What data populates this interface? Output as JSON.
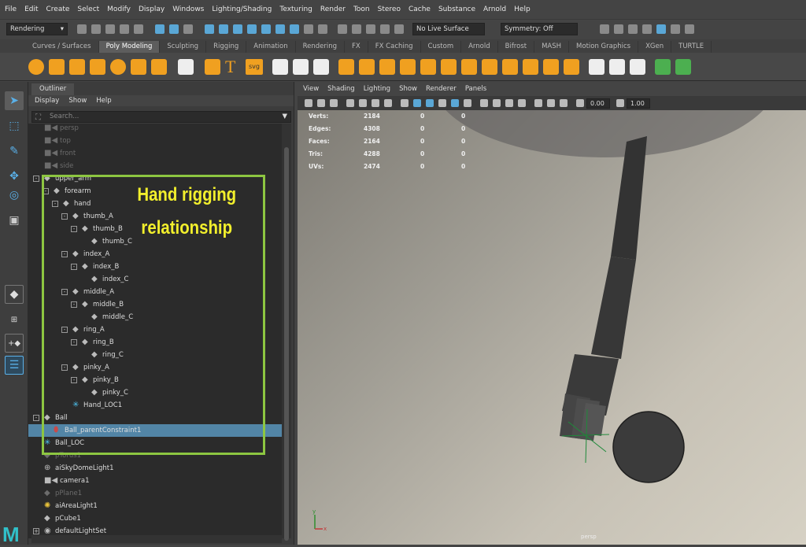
{
  "menubar": {
    "items": [
      "File",
      "Edit",
      "Create",
      "Select",
      "Modify",
      "Display",
      "Windows",
      "Lighting/Shading",
      "Texturing",
      "Render",
      "Toon",
      "Stereo",
      "Cache",
      "Substance",
      "Arnold",
      "Help"
    ]
  },
  "statusline": {
    "menuset": "Rendering",
    "live_surface": "No Live Surface",
    "symmetry": "Symmetry: Off"
  },
  "shelf": {
    "tabs": [
      "Curves / Surfaces",
      "Poly Modeling",
      "Sculpting",
      "Rigging",
      "Animation",
      "Rendering",
      "FX",
      "FX Caching",
      "Custom",
      "Arnold",
      "Bifrost",
      "MASH",
      "Motion Graphics",
      "XGen",
      "TURTLE"
    ],
    "active": "Poly Modeling",
    "text_tool": "T",
    "svg_tool": "svg"
  },
  "outliner": {
    "tab": "Outliner",
    "menu": [
      "Display",
      "Show",
      "Help"
    ],
    "search_placeholder": "Search...",
    "items": [
      {
        "label": "persp",
        "icon": "camera-icon",
        "depth": 0,
        "toggle": "",
        "dim": true
      },
      {
        "label": "top",
        "icon": "camera-icon",
        "depth": 0,
        "toggle": "",
        "dim": true
      },
      {
        "label": "front",
        "icon": "camera-icon",
        "depth": 0,
        "toggle": "",
        "dim": true
      },
      {
        "label": "side",
        "icon": "camera-icon",
        "depth": 0,
        "toggle": "",
        "dim": true
      },
      {
        "label": "upper_arm",
        "icon": "joint-icon",
        "depth": 0,
        "toggle": "-"
      },
      {
        "label": "forearm",
        "icon": "joint-icon",
        "depth": 1,
        "toggle": "-"
      },
      {
        "label": "hand",
        "icon": "joint-icon",
        "depth": 2,
        "toggle": "-"
      },
      {
        "label": "thumb_A",
        "icon": "joint-icon",
        "depth": 3,
        "toggle": "-"
      },
      {
        "label": "thumb_B",
        "icon": "joint-icon",
        "depth": 4,
        "toggle": "-"
      },
      {
        "label": "thumb_C",
        "icon": "joint-icon",
        "depth": 5,
        "toggle": ""
      },
      {
        "label": "index_A",
        "icon": "joint-icon",
        "depth": 3,
        "toggle": "-"
      },
      {
        "label": "index_B",
        "icon": "joint-icon",
        "depth": 4,
        "toggle": "-"
      },
      {
        "label": "index_C",
        "icon": "joint-icon",
        "depth": 5,
        "toggle": ""
      },
      {
        "label": "middle_A",
        "icon": "joint-icon",
        "depth": 3,
        "toggle": "-"
      },
      {
        "label": "middle_B",
        "icon": "joint-icon",
        "depth": 4,
        "toggle": "-"
      },
      {
        "label": "middle_C",
        "icon": "joint-icon",
        "depth": 5,
        "toggle": ""
      },
      {
        "label": "ring_A",
        "icon": "joint-icon",
        "depth": 3,
        "toggle": "-"
      },
      {
        "label": "ring_B",
        "icon": "joint-icon",
        "depth": 4,
        "toggle": "-"
      },
      {
        "label": "ring_C",
        "icon": "joint-icon",
        "depth": 5,
        "toggle": ""
      },
      {
        "label": "pinky_A",
        "icon": "joint-icon",
        "depth": 3,
        "toggle": "-"
      },
      {
        "label": "pinky_B",
        "icon": "joint-icon",
        "depth": 4,
        "toggle": "-"
      },
      {
        "label": "pinky_C",
        "icon": "joint-icon",
        "depth": 5,
        "toggle": ""
      },
      {
        "label": "Hand_LOC1",
        "icon": "locator-icon",
        "depth": 3,
        "toggle": ""
      },
      {
        "label": "Ball",
        "icon": "joint-icon",
        "depth": 0,
        "toggle": "-"
      },
      {
        "label": "Ball_parentConstraint1",
        "icon": "constraint-icon",
        "depth": 1,
        "toggle": "",
        "selected": true
      },
      {
        "label": "Ball_LOC",
        "icon": "locator-icon",
        "depth": 0,
        "toggle": ""
      },
      {
        "label": "pTorus1",
        "icon": "mesh-icon",
        "depth": 0,
        "toggle": "",
        "dim": true
      },
      {
        "label": "aiSkyDomeLight1",
        "icon": "skydome-icon",
        "depth": 0,
        "toggle": ""
      },
      {
        "label": "camera1",
        "icon": "camera-icon",
        "depth": 0,
        "toggle": ""
      },
      {
        "label": "pPlane1",
        "icon": "mesh-icon",
        "depth": 0,
        "toggle": "",
        "dim": true
      },
      {
        "label": "aiAreaLight1",
        "icon": "light-icon",
        "depth": 0,
        "toggle": ""
      },
      {
        "label": "pCube1",
        "icon": "mesh-icon",
        "depth": 0,
        "toggle": ""
      },
      {
        "label": "defaultLightSet",
        "icon": "set-icon",
        "depth": 0,
        "toggle": "+"
      }
    ]
  },
  "annotation": {
    "line1": "Hand rigging",
    "line2": "relationship",
    "color": "#f2ef2c",
    "box_color": "#8dc641"
  },
  "viewport": {
    "menu": [
      "View",
      "Shading",
      "Lighting",
      "Show",
      "Renderer",
      "Panels"
    ],
    "field1": "0.00",
    "field2": "1.00",
    "hud": [
      {
        "label": "Verts:",
        "v1": "2184",
        "v2": "0",
        "v3": "0"
      },
      {
        "label": "Edges:",
        "v1": "4308",
        "v2": "0",
        "v3": "0"
      },
      {
        "label": "Faces:",
        "v1": "2164",
        "v2": "0",
        "v3": "0"
      },
      {
        "label": "Tris:",
        "v1": "4288",
        "v2": "0",
        "v3": "0"
      },
      {
        "label": "UVs:",
        "v1": "2474",
        "v2": "0",
        "v3": "0"
      }
    ],
    "camera_label": "persp",
    "axis_y": "y",
    "axis_x": "x"
  },
  "colors": {
    "accent": "#5aa7d6",
    "selection": "#5285a6"
  }
}
